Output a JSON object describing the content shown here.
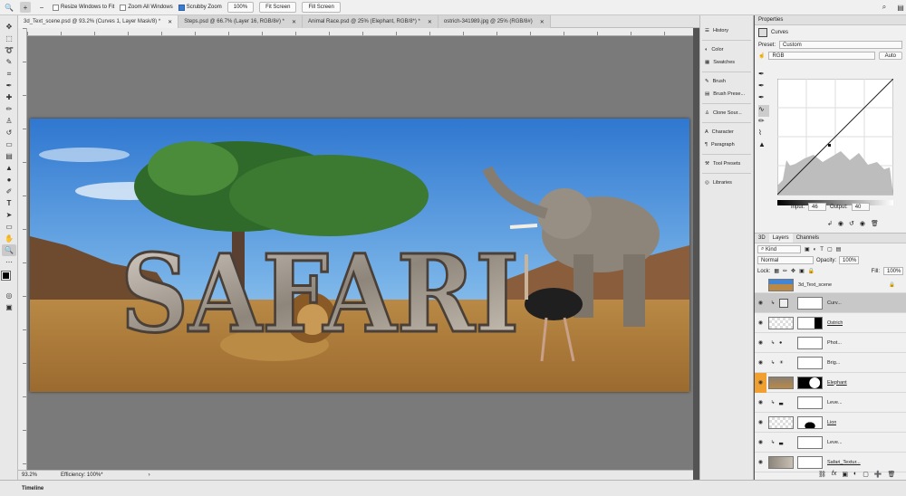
{
  "options_bar": {
    "resize_windows": "Resize Windows to Fit",
    "zoom_all": "Zoom All Windows",
    "scrubby_zoom": "Scrubby Zoom",
    "btn_100": "100%",
    "btn_fit": "Fit Screen",
    "btn_fill": "Fill Screen"
  },
  "tabs": [
    {
      "label": "3d_Text_scene.psd @ 93.2% (Curves 1, Layer Mask/8) *"
    },
    {
      "label": "Steps.psd @ 66.7% (Layer 16, RGB/8#) *"
    },
    {
      "label": "Animal Race.psd @ 25% (Elephant, RGB/8*) *"
    },
    {
      "label": "ostrich-341989.jpg @ 25% (RGB/8#)"
    }
  ],
  "artwork": {
    "title_text": "SAFARI"
  },
  "status": {
    "zoom": "93.2%",
    "efficiency": "Efficiency: 100%*"
  },
  "timeline": "Timeline",
  "dock": {
    "items": [
      "History",
      "Color",
      "Swatches",
      "Brush",
      "Brush Prese...",
      "Clone Sour...",
      "Character",
      "Paragraph",
      "Tool Presets",
      "Libraries"
    ]
  },
  "properties": {
    "tab": "Properties",
    "title": "Curves",
    "preset_label": "Preset:",
    "preset_value": "Custom",
    "channel": "RGB",
    "auto": "Auto",
    "input_label": "Input:",
    "input_value": "46",
    "output_label": "Output:",
    "output_value": "40"
  },
  "layers_panel": {
    "tabs": [
      "3D",
      "Layers",
      "Channels"
    ],
    "kind": "Kind",
    "blend": "Normal",
    "opacity_label": "Opacity:",
    "opacity": "100%",
    "lock_label": "Lock:",
    "fill_label": "Fill:",
    "fill": "100%",
    "layers": [
      {
        "name": "3d_Text_scene"
      },
      {
        "name": "Curv..."
      },
      {
        "name": "Ostrich"
      },
      {
        "name": "Phot..."
      },
      {
        "name": "Brig..."
      },
      {
        "name": "Elephant"
      },
      {
        "name": "Leve..."
      },
      {
        "name": "Lion"
      },
      {
        "name": "Leve..."
      },
      {
        "name": "Safari_Textur..."
      }
    ]
  },
  "colors": {
    "accent": "#3b7bd4",
    "sky": "#3f86d8",
    "sand": "#c89a55"
  }
}
